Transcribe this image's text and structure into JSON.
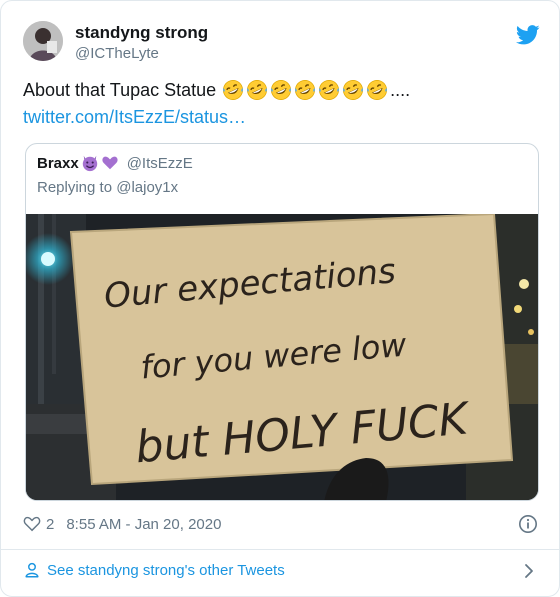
{
  "author": {
    "display_name": "standyng strong",
    "handle": "@ICTheLyte"
  },
  "tweet": {
    "text": "About that Tupac Statue",
    "emoji_icon": "rolling-on-floor-laughing-icon",
    "emoji_count": 7,
    "trailing": "....",
    "link": "twitter.com/ItsEzzE/status…"
  },
  "quoted": {
    "display_name": "Braxx",
    "emojis": [
      "smiling-devil-icon",
      "purple-heart-icon"
    ],
    "handle": "@ItsEzzE",
    "reply_line": "Replying to @lajoy1x",
    "sign_lines": [
      "Our expectations",
      "for you were low",
      "but HOLY FUCK"
    ]
  },
  "meta": {
    "like_count": "2",
    "timestamp": "8:55 AM - Jan 20, 2020"
  },
  "footer": {
    "see_more": "See standyng strong's other Tweets"
  },
  "colors": {
    "link": "#1b95e0",
    "muted": "#657786",
    "border": "#e1e8ed"
  }
}
